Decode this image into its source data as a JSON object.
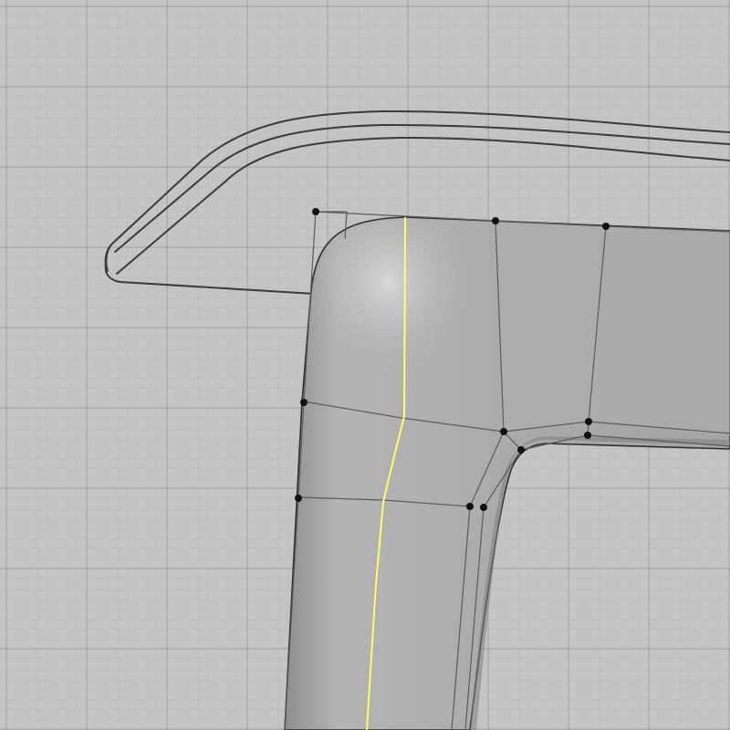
{
  "viewport": {
    "view": "3d-modeling-viewport",
    "background_color": "#c4c4c4",
    "grid": {
      "visible": true,
      "minor_color": "#b9b9b9",
      "major_color": "#a8a8a8"
    }
  },
  "objects": {
    "background_part": {
      "kind": "wireframe-curve-outline",
      "color": "#3a3a3a"
    },
    "selected_surface": {
      "kind": "shaded-subd-surface",
      "fill_color": "#a8a8a8",
      "edge_color": "#555555",
      "control_point_color": "#111111",
      "control_point_count": 12,
      "selected_edge_color": "#ffff66"
    }
  }
}
